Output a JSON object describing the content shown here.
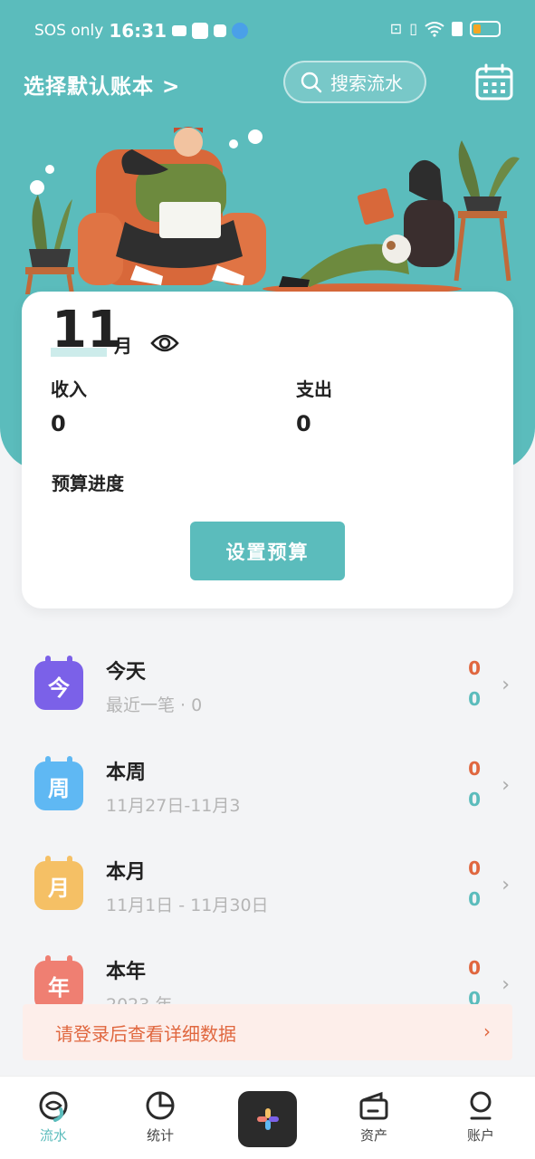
{
  "status_bar": {
    "carrier": "SOS only",
    "time": "16:31"
  },
  "header": {
    "book_select": "选择默认账本 >",
    "search_label": "搜索流水"
  },
  "summary": {
    "month_number": "11",
    "month_unit": "月",
    "income_label": "收入",
    "income_value": "0",
    "expense_label": "支出",
    "expense_value": "0",
    "budget_label": "预算进度",
    "budget_button": "设置预算"
  },
  "periods": [
    {
      "icon_char": "今",
      "icon_color": "#7b61e8",
      "title": "今天",
      "subtitle": "最近一笔 · 0",
      "income": "0",
      "expense": "0"
    },
    {
      "icon_char": "周",
      "icon_color": "#5fb8f3",
      "title": "本周",
      "subtitle": "11月27日-11月3",
      "income": "0",
      "expense": "0"
    },
    {
      "icon_char": "月",
      "icon_color": "#f5c065",
      "title": "本月",
      "subtitle": "11月1日 - 11月30日",
      "income": "0",
      "expense": "0"
    },
    {
      "icon_char": "年",
      "icon_color": "#ef7f72",
      "title": "本年",
      "subtitle": "2023 年",
      "income": "0",
      "expense": "0"
    }
  ],
  "login_prompt": "请登录后查看详细数据",
  "tabs": [
    {
      "label": "流水",
      "icon": "ledger-icon",
      "active": true
    },
    {
      "label": "统计",
      "icon": "pie-chart-icon",
      "active": false
    },
    {
      "label": "",
      "icon": "plus-icon",
      "active": false
    },
    {
      "label": "资产",
      "icon": "wallet-icon",
      "active": false
    },
    {
      "label": "账户",
      "icon": "user-icon",
      "active": false
    }
  ],
  "colors": {
    "primary": "#5bbcbc",
    "income": "#e0673f",
    "expense": "#5bbcbc",
    "add_button": "#2b2b2b"
  }
}
